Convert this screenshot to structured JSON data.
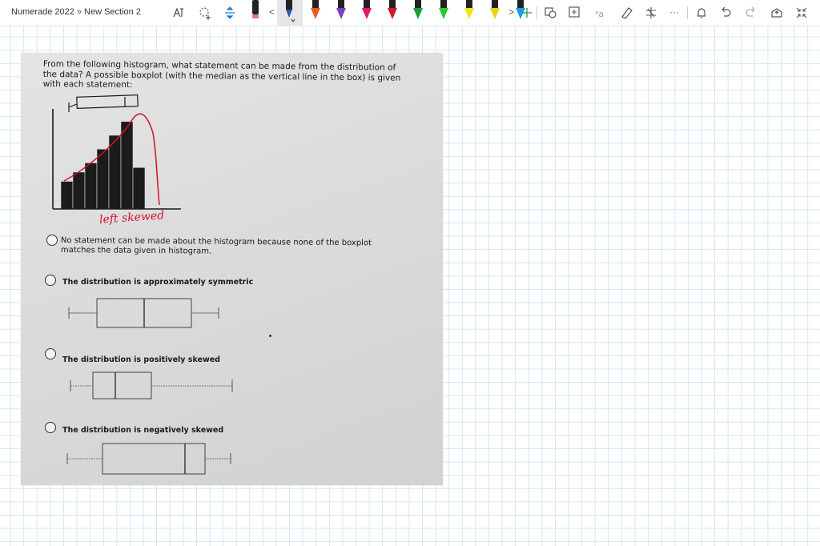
{
  "toolbar": {
    "title_app": "Numerade 2022",
    "title_sep": "»",
    "title_section": "New Section 2",
    "next_arrow": ">",
    "prev_arrow": "<",
    "more": "···",
    "pen_colors": [
      "#1f5bb5",
      "#e85c1b",
      "#7b3fc6",
      "#e0186c",
      "#d41a2a",
      "#1f9e3a",
      "#35c43a",
      "#f5e21b",
      "#e8d511",
      "#1b9fe8"
    ],
    "pink_marker": "#e06ab8"
  },
  "question": {
    "text": "From the following histogram, what statement can be made from the distribution of the data? A possible boxplot (with the median as the vertical line in the box) is given with each statement:"
  },
  "annotation": {
    "text": "left skewed",
    "color": "#d0102a"
  },
  "histogram": {
    "bars": [
      3,
      4,
      5,
      6.5,
      8,
      9.5,
      4.5
    ]
  },
  "options": [
    {
      "text": "No statement can be made about the histogram because none of the boxplot matches the data given in histogram."
    },
    {
      "text": "The distribution is approximately symmetric"
    },
    {
      "text": "The distribution is positively skewed"
    },
    {
      "text": "The distribution is negatively skewed"
    }
  ]
}
